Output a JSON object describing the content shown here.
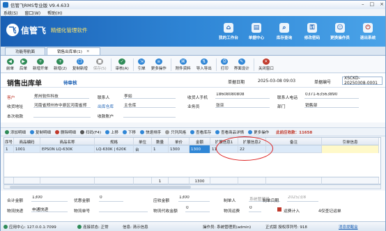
{
  "window": {
    "title": "信管飞RMS专业版 V9.4.633"
  },
  "menu": [
    "系统(S)",
    "窗口(W)",
    "帮助(H)"
  ],
  "banner": {
    "logo_mark": "飞",
    "name": "信管飞",
    "slogan": "精细化管理软件",
    "buttons": [
      {
        "label": "我的工作台",
        "icon": "home-icon"
      },
      {
        "label": "单据中心",
        "icon": "document-icon"
      },
      {
        "label": "库存查询",
        "icon": "search-icon"
      },
      {
        "label": "修改密码",
        "icon": "key-icon"
      },
      {
        "label": "更换操作员",
        "icon": "user-icon"
      },
      {
        "label": "退出系统",
        "icon": "exit-icon"
      }
    ]
  },
  "tabs": [
    {
      "label": "功能导航面"
    },
    {
      "label": "销售出库单(1)"
    }
  ],
  "toolbar": [
    {
      "label": "前单",
      "icon": "prev-icon",
      "color": "#2e8b57"
    },
    {
      "label": "后单",
      "icon": "next-icon",
      "color": "#2e8b57"
    },
    {
      "label": "新增开单",
      "icon": "plus-icon",
      "color": "#2e8b57"
    },
    {
      "label": "新增(2)",
      "icon": "plus-icon",
      "color": "#2e8b57"
    },
    {
      "label": "复制新增",
      "icon": "copy-icon",
      "color": "#2f86d6"
    },
    {
      "label": "保存(S)",
      "icon": "save-icon",
      "color": "#999999"
    },
    {
      "label": "审核(A)",
      "icon": "check-icon",
      "color": "#2e8b57"
    },
    {
      "label": "引单",
      "icon": "import-icon",
      "color": "#2f86d6"
    },
    {
      "label": "更多操作",
      "icon": "more-icon",
      "color": "#2f86d6"
    },
    {
      "label": "附件资料",
      "icon": "attachment-icon",
      "color": "#2f86d6"
    },
    {
      "label": "导入导出",
      "icon": "import-export-icon",
      "color": "#2f86d6"
    },
    {
      "label": "打印",
      "icon": "print-icon",
      "color": "#2f86d6"
    },
    {
      "label": "界面设计",
      "icon": "design-icon",
      "color": "#2f86d6"
    },
    {
      "label": "关闭窗口",
      "icon": "close-icon",
      "color": "#c0392b"
    }
  ],
  "doc": {
    "title": "销售出库单",
    "status": "待审核",
    "date_label": "单据日期",
    "date": "2025-03-08 09:03",
    "no_label": "单据编号",
    "no": "XSCKD-20250308-0001"
  },
  "fields": {
    "customer_label": "客户",
    "customer": "郑州软件科技",
    "contact_label": "联系人",
    "contact": "李如",
    "phone_label": "收货人手机",
    "phone": "18608080808",
    "tel_label": "联系人电话",
    "tel": "0371-63563890",
    "address_label": "收货地址",
    "address": "河南省郑州市中原区河南省郑",
    "warehouse_label": "出库仓库",
    "warehouse": "主仓库",
    "salesman_label": "业务员",
    "salesman": "张亚",
    "dept_label": "部门",
    "dept": "销售部",
    "remark_label": "本次收款",
    "remark": "",
    "account_label": "收款账户",
    "account": ""
  },
  "gridbar": {
    "buttons": [
      "添加明细",
      "复制明细",
      "删除明细",
      "扫码(F4)",
      "上移",
      "下移",
      "快速排序",
      "只列风格",
      "查看库存",
      "查看商品详情",
      "更多操作"
    ],
    "count_label": "此前应收款：11658"
  },
  "grid": {
    "headers": [
      "序号",
      "商品编码",
      "商品名称",
      "规格",
      "单位",
      "数量",
      "单价",
      "金额",
      "扩展信息1",
      "扩展信息2",
      "备注",
      "引单信息"
    ],
    "rows": [
      [
        "1",
        "1001",
        "EPSON LQ-630K",
        "LQ-630K | 620K",
        "台",
        "1",
        "1300",
        "1300",
        "11",
        "22",
        "",
        ""
      ]
    ],
    "totals": [
      "",
      "",
      "",
      "",
      "",
      "1",
      "",
      "1300",
      "",
      "",
      "",
      ""
    ]
  },
  "footer": {
    "total_label": "合计金额",
    "total": "1300",
    "discount_label": "优惠金额",
    "discount": "0",
    "receivable_label": "应收金额",
    "receivable": "1300",
    "maker_label": "制单人",
    "maker": "系统管理员",
    "make_date_label": "制单日期",
    "make_date": "2025/3/8",
    "ship_label": "物流快递",
    "ship": "申通快递",
    "ship_no_label": "物流单号",
    "ship_no": "",
    "cod_label": "物流代收金额",
    "cod": "0",
    "freight_label": "物流运费",
    "freight": "0",
    "freight_check_label": "运费计入",
    "count_label": "4仅查记运单"
  },
  "status": {
    "server": "应用中心: 127.0.0.1:7099",
    "conn": "连接状态: 正常",
    "msg": "信息: 清示信息",
    "operator": "操作员: 系统管理员(admin)",
    "edition": "正式版 授权序列号: 918",
    "link": "消息提醒盒"
  }
}
